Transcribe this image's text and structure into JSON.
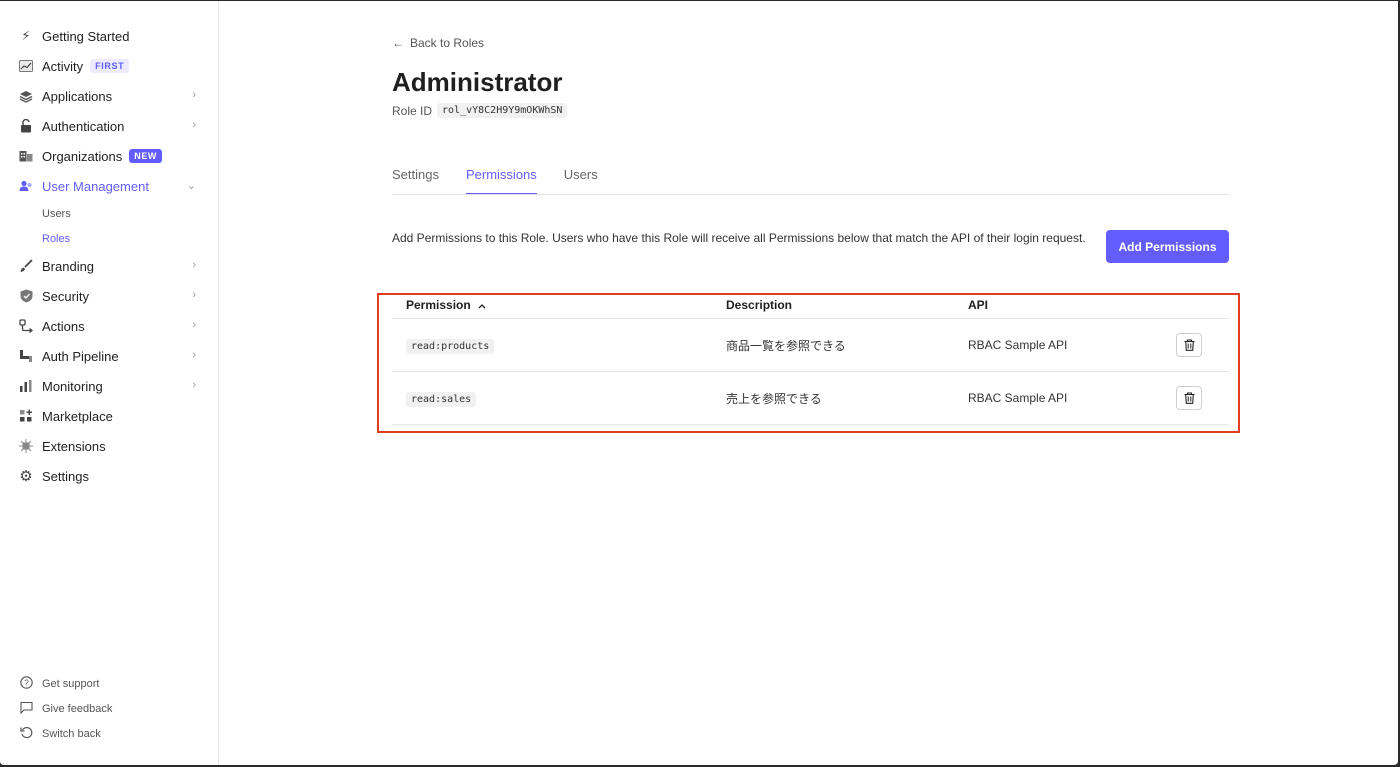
{
  "sidebar": {
    "items": [
      {
        "label": "Getting Started",
        "icon": "lightning-icon",
        "glyph": "⚡"
      },
      {
        "label": "Activity",
        "icon": "activity-icon",
        "glyph": "📈",
        "badge": "FIRST"
      },
      {
        "label": "Applications",
        "icon": "layers-icon",
        "glyph": "◈"
      },
      {
        "label": "Authentication",
        "icon": "lock-icon",
        "glyph": "🔓"
      },
      {
        "label": "Organizations",
        "icon": "building-icon",
        "glyph": "▦",
        "badge": "NEW"
      },
      {
        "label": "User Management",
        "icon": "users-icon",
        "glyph": "👥"
      },
      {
        "label": "Branding",
        "icon": "brush-icon",
        "glyph": "✎"
      },
      {
        "label": "Security",
        "icon": "shield-icon",
        "glyph": "⛉"
      },
      {
        "label": "Actions",
        "icon": "actions-icon",
        "glyph": "⇆"
      },
      {
        "label": "Auth Pipeline",
        "icon": "pipeline-icon",
        "glyph": "↳"
      },
      {
        "label": "Monitoring",
        "icon": "bar-chart-icon",
        "glyph": "▮"
      },
      {
        "label": "Marketplace",
        "icon": "grid-plus-icon",
        "glyph": "⊞"
      },
      {
        "label": "Extensions",
        "icon": "extension-icon",
        "glyph": "✷"
      },
      {
        "label": "Settings",
        "icon": "gear-icon",
        "glyph": "⚙"
      }
    ],
    "sub_items": {
      "users": "Users",
      "roles": "Roles"
    },
    "footer": [
      {
        "label": "Get support",
        "icon": "help-circle-icon",
        "glyph": "?"
      },
      {
        "label": "Give feedback",
        "icon": "message-icon",
        "glyph": "▭"
      },
      {
        "label": "Switch back",
        "icon": "undo-icon",
        "glyph": "↺"
      }
    ]
  },
  "page": {
    "back_label": "Back to Roles",
    "title": "Administrator",
    "role_id_label": "Role ID",
    "role_id": "rol_vY8C2H9Y9mOKWhSN",
    "tabs": [
      "Settings",
      "Permissions",
      "Users"
    ],
    "active_tab": "Permissions",
    "intro": "Add Permissions to this Role. Users who have this Role will receive all Permissions below that match the API of their login request.",
    "add_button": "Add Permissions"
  },
  "table": {
    "headers": {
      "permission": "Permission",
      "description": "Description",
      "api": "API"
    },
    "sort_indicator": "^",
    "rows": [
      {
        "permission": "read:products",
        "description": "商品一覧を参照できる",
        "api": "RBAC Sample API"
      },
      {
        "permission": "read:sales",
        "description": "売上を参照できる",
        "api": "RBAC Sample API"
      }
    ]
  },
  "colors": {
    "accent": "#635dff",
    "highlight_border": "#e13d1f"
  }
}
